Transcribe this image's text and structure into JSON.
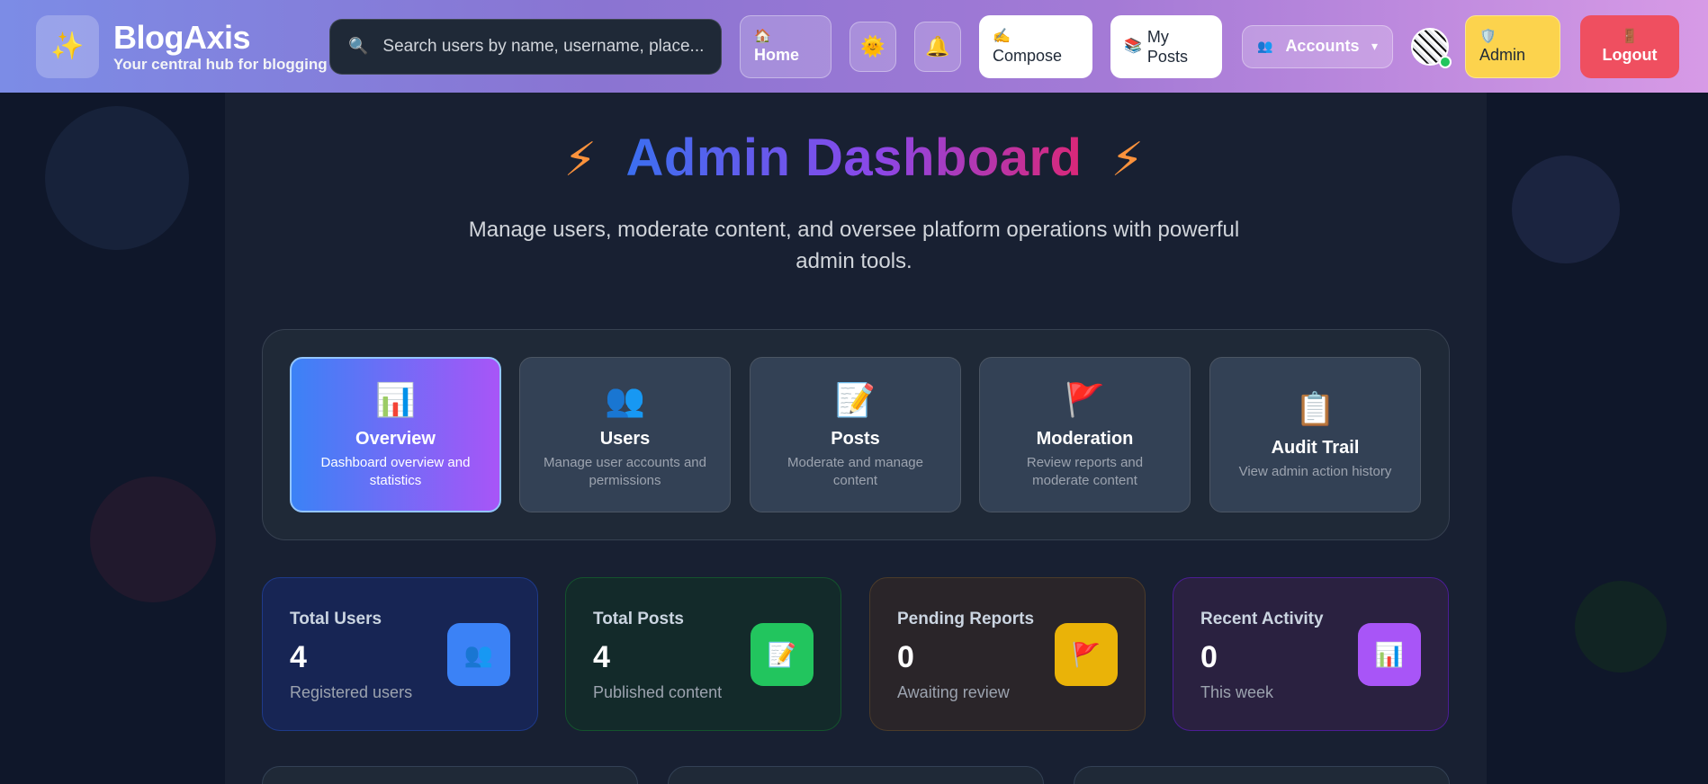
{
  "header": {
    "brand_name": "BlogAxis",
    "brand_tagline": "Your central hub for blogging",
    "search_placeholder": "Search users by name, username, place...",
    "home_label": "Home",
    "compose_label": "Compose",
    "my_posts_label": "My Posts",
    "accounts_label": "Accounts",
    "admin_label": "Admin",
    "logout_label": "Logout"
  },
  "hero": {
    "title": "Admin Dashboard",
    "subtitle": "Manage users, moderate content, and oversee platform operations with powerful admin tools."
  },
  "tabs": [
    {
      "title": "Overview",
      "desc": "Dashboard overview and statistics",
      "icon": "bar-chart-icon"
    },
    {
      "title": "Users",
      "desc": "Manage user accounts and permissions",
      "icon": "users-icon"
    },
    {
      "title": "Posts",
      "desc": "Moderate and manage content",
      "icon": "document-icon"
    },
    {
      "title": "Moderation",
      "desc": "Review reports and moderate content",
      "icon": "flag-icon"
    },
    {
      "title": "Audit Trail",
      "desc": "View admin action history",
      "icon": "clipboard-icon"
    }
  ],
  "stats": [
    {
      "label": "Total Users",
      "value": "4",
      "sub": "Registered users",
      "icon": "users-icon",
      "color": "#3b82f6"
    },
    {
      "label": "Total Posts",
      "value": "4",
      "sub": "Published content",
      "icon": "document-icon",
      "color": "#22c55e"
    },
    {
      "label": "Pending Reports",
      "value": "0",
      "sub": "Awaiting review",
      "icon": "flag-icon",
      "color": "#eab308"
    },
    {
      "label": "Recent Activity",
      "value": "0",
      "sub": "This week",
      "icon": "bar-chart-icon",
      "color": "#a855f7"
    }
  ]
}
